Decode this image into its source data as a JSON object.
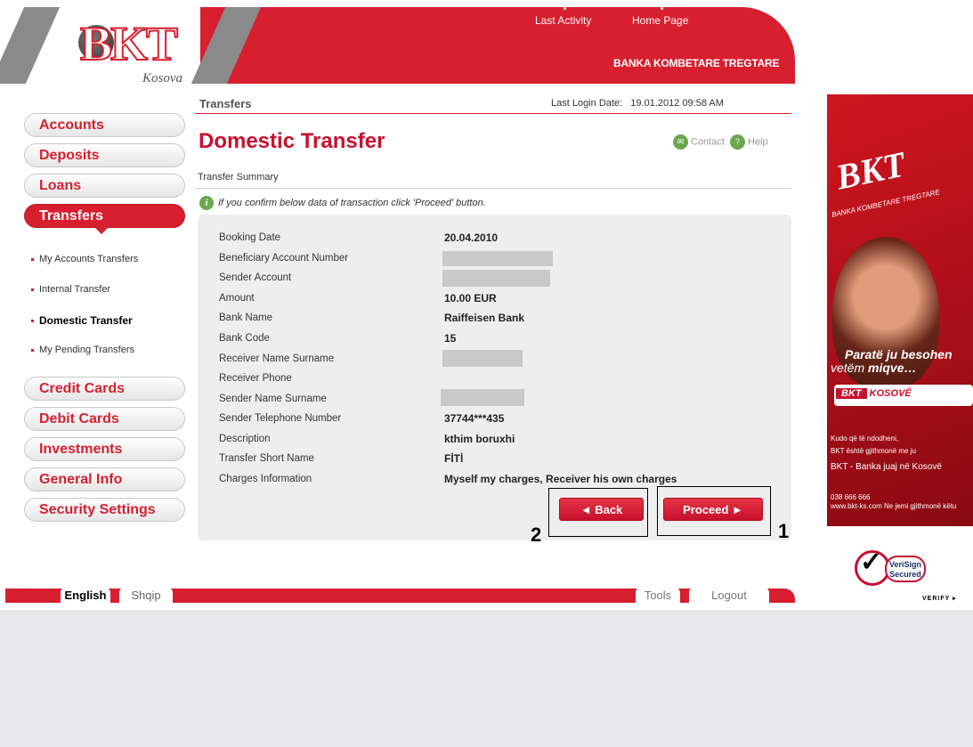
{
  "header": {
    "logo_text": "BKT",
    "logo_subtext": "Kosova",
    "top_links": [
      "Last Activity",
      "Home Page"
    ],
    "bank_name": "BANKA KOMBETARE TREGTARE"
  },
  "sidebar": {
    "items": [
      {
        "label": "Accounts"
      },
      {
        "label": "Deposits"
      },
      {
        "label": "Loans"
      },
      {
        "label": "Transfers"
      },
      {
        "label": "Credit Cards"
      },
      {
        "label": "Debit Cards"
      },
      {
        "label": "Investments"
      },
      {
        "label": "General Info"
      },
      {
        "label": "Security Settings"
      }
    ],
    "sub_items": [
      {
        "label": "My Accounts Transfers"
      },
      {
        "label": "Internal Transfer"
      },
      {
        "label": "Domestic Transfer"
      },
      {
        "label": "My Pending Transfers"
      }
    ]
  },
  "main": {
    "breadcrumb": "Transfers",
    "last_login_label": "Last Login Date:",
    "last_login_value": "19.01.2012 09:58 AM",
    "title": "Domestic Transfer",
    "contact_label": "Contact",
    "help_label": "Help",
    "section": "Transfer Summary",
    "info_text": "If you confirm below data of transaction click 'Proceed' button.",
    "rows": [
      {
        "label": "Booking Date",
        "value": "20.04.2010"
      },
      {
        "label": "Beneficiary Account Number",
        "value": ""
      },
      {
        "label": "Sender Account",
        "value": ""
      },
      {
        "label": "Amount",
        "value": "10.00 EUR"
      },
      {
        "label": "Bank Name",
        "value": "Raiffeisen Bank"
      },
      {
        "label": "Bank Code",
        "value": "15"
      },
      {
        "label": "Receiver Name Surname",
        "value": ""
      },
      {
        "label": "Receiver Phone",
        "value": ""
      },
      {
        "label": "Sender Name Surname",
        "value": ""
      },
      {
        "label": "Sender Telephone Number",
        "value": "37744***435"
      },
      {
        "label": "Description",
        "value": "kthim boruxhi"
      },
      {
        "label": "Transfer Short Name",
        "value": "FİTİ"
      },
      {
        "label": "Charges Information",
        "value": "Myself my charges, Receiver his own charges"
      }
    ],
    "back_label": "◄ Back",
    "proceed_label": "Proceed ►",
    "callout_1": "1",
    "callout_2": "2"
  },
  "footer": {
    "english": "English",
    "shqip": "Shqip",
    "tools": "Tools",
    "logout": "Logout"
  },
  "ad": {
    "logo": "BKT",
    "logo_sub": "BANKA KOMBETARE TREGTARE",
    "headline1": "Paratë ju besohen",
    "headline2_pre": "vetëm ",
    "headline2_bold": "miqve…",
    "badge": "KOSOVË",
    "line1": "Kudo që të ndodheni,",
    "line2": "BKT është gjithmonë me ju",
    "line3": "BKT - Banka juaj në Kosovë",
    "line4": "038 666 666",
    "line5": "www.bkt-ks.com    Ne jemi gjithmonë këtu"
  },
  "verisign": {
    "line1": "VeriSign",
    "line2": "Secured",
    "verify": "VERIFY ▸"
  }
}
